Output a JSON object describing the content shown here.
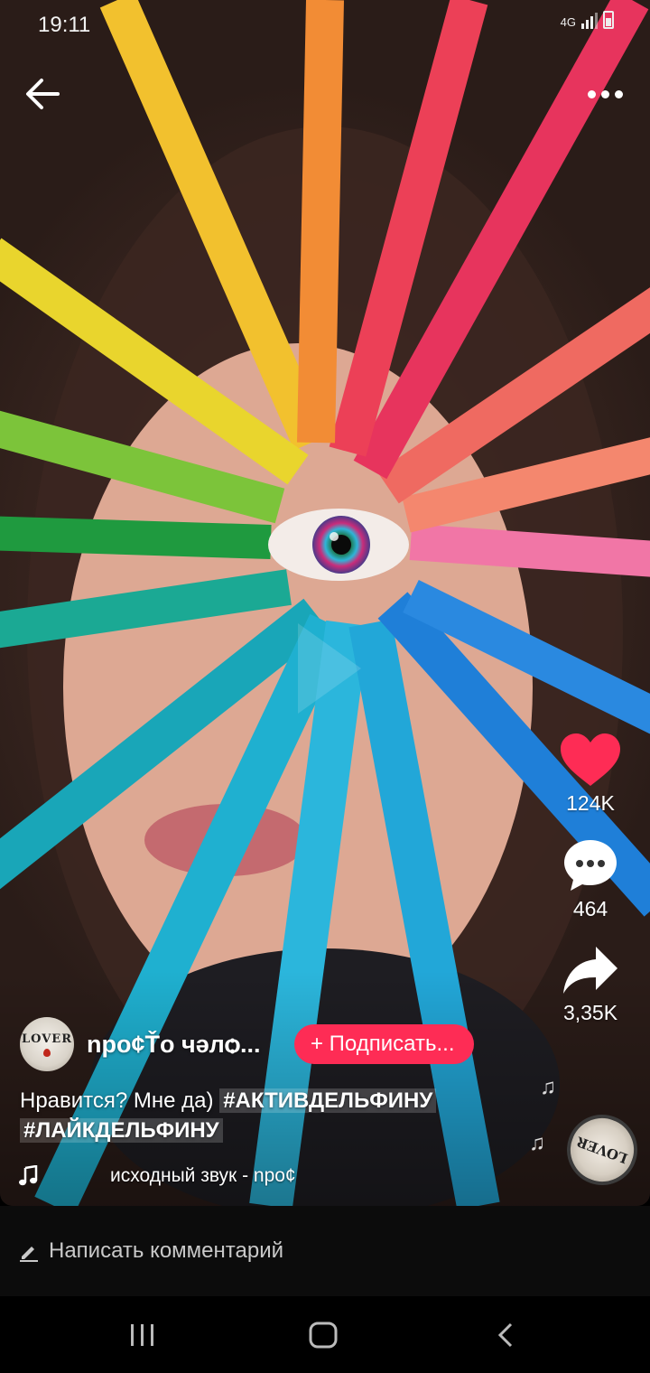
{
  "status_bar": {
    "time": "19:11",
    "network": "4G"
  },
  "actions": {
    "likes": "124K",
    "comments": "464",
    "shares": "3,35K"
  },
  "author": {
    "avatar_text": "LOVER",
    "name": "npo¢Ťo чәлѻ...",
    "follow_label": "+ Подписать..."
  },
  "caption": {
    "text": "Нравится? Мне да) ",
    "hashtags": [
      "#АКТИВДЕЛЬФИНУ",
      "#ЛАЙКДЕЛЬФИНУ"
    ]
  },
  "music": {
    "title": "исходный звук - npo¢"
  },
  "sound_disc": {
    "text": "LOVER"
  },
  "comment_bar": {
    "placeholder": "Написать комментарий"
  },
  "colors": {
    "accent": "#fe2c55",
    "like": "#fe2c55"
  }
}
